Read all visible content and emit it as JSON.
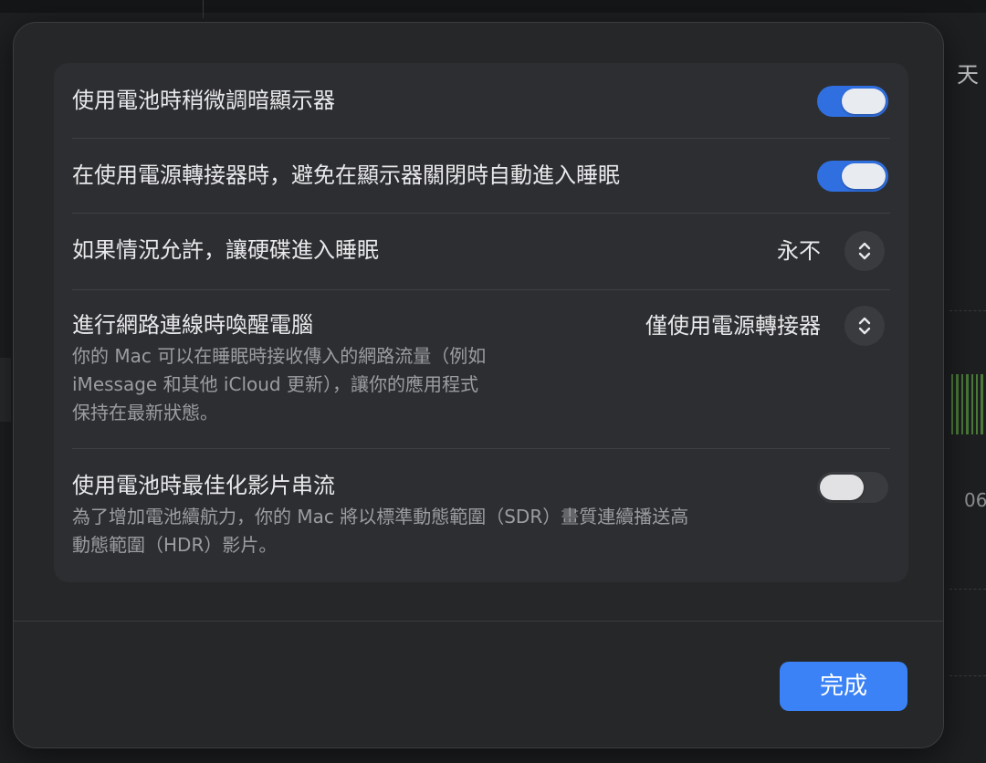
{
  "background": {
    "right_top_char": "天",
    "right_axis_label": "06"
  },
  "settings": {
    "rows": [
      {
        "title": "使用電池時稍微調暗顯示器",
        "control": "toggle",
        "on": true
      },
      {
        "title": "在使用電源轉接器時，避免在顯示器關閉時自動進入睡眠",
        "control": "toggle",
        "on": true
      },
      {
        "title": "如果情況允許，讓硬碟進入睡眠",
        "control": "popup",
        "value": "永不"
      },
      {
        "title": "進行網路連線時喚醒電腦",
        "control": "popup",
        "value": "僅使用電源轉接器",
        "description": "你的 Mac 可以在睡眠時接收傳入的網路流量（例如\niMessage 和其他 iCloud 更新），讓你的應用程式\n保持在最新狀態。"
      },
      {
        "title": "使用電池時最佳化影片串流",
        "control": "toggle",
        "on": false,
        "description": "為了增加電池續航力，你的 Mac 將以標準動態範圍（SDR）畫質連續播送高\n動態範圍（HDR）影片。"
      }
    ]
  },
  "footer": {
    "done_label": "完成"
  },
  "colors": {
    "accent": "#3a82f6",
    "toggle_on": "#2f6fe0",
    "sheet_bg": "#262729",
    "group_bg": "#2d2e31"
  },
  "icons": {
    "popup_stepper": "chevron-up-down-icon"
  }
}
